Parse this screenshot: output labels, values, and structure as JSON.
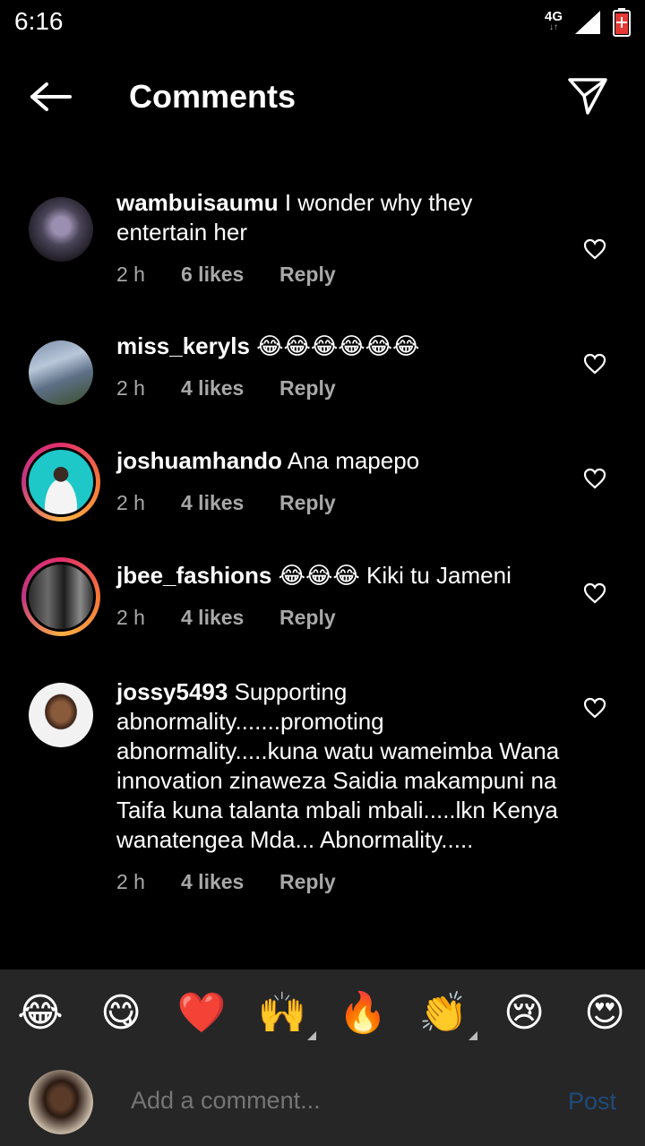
{
  "status_bar": {
    "time": "6:16",
    "network": "4G",
    "network_arrows": "↓↑"
  },
  "header": {
    "title": "Comments"
  },
  "comments": [
    {
      "username": "wambuisaumu",
      "text": "I wonder why they entertain her",
      "time": "2 h",
      "likes": "6 likes",
      "reply": "Reply"
    },
    {
      "username": "miss_keryls",
      "text": "😂😂😂😂😂😂",
      "time": "2 h",
      "likes": "4 likes",
      "reply": "Reply"
    },
    {
      "username": "joshuamhando",
      "text": "Ana mapepo",
      "time": "2 h",
      "likes": "4 likes",
      "reply": "Reply"
    },
    {
      "username": "jbee_fashions",
      "text": "😂😂😂 Kiki tu Jameni",
      "time": "2 h",
      "likes": "4 likes",
      "reply": "Reply"
    },
    {
      "username": "jossy5493",
      "text": "Supporting abnormality.......promoting abnormality.....kuna watu wameimba Wana innovation zinaweza Saidia makampuni na Taifa kuna talanta mbali mbali.....lkn Kenya wanatengea Mda... Abnormality.....",
      "time": "2 h",
      "likes": "4 likes",
      "reply": "Reply"
    }
  ],
  "reactions": [
    "😂",
    "😋",
    "❤️",
    "🙌",
    "🔥",
    "👏",
    "😢",
    "😍"
  ],
  "composer": {
    "placeholder": "Add a comment...",
    "post_label": "Post"
  },
  "colors": {
    "background": "#000000",
    "bar": "#262626",
    "muted": "#a8a8a8",
    "post": "#1f4a7a"
  }
}
